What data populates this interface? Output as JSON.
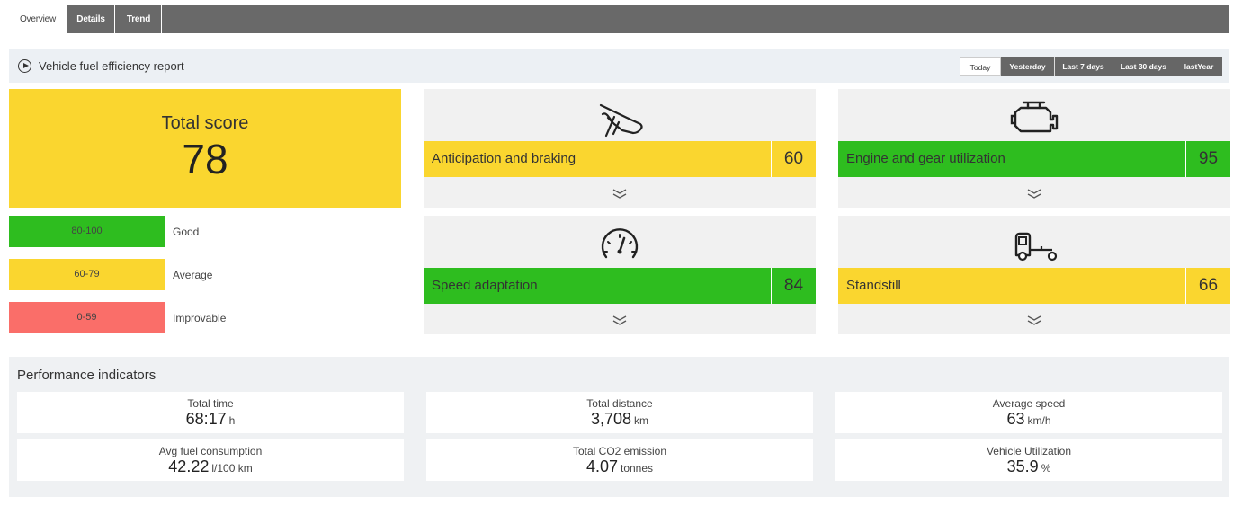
{
  "tabs": [
    {
      "label": "Overview",
      "active": true
    },
    {
      "label": "Details",
      "active": false
    },
    {
      "label": "Trend",
      "active": false
    }
  ],
  "header": {
    "title": "Vehicle fuel efficiency report"
  },
  "periods": [
    {
      "label": "Today",
      "active": true
    },
    {
      "label": "Yesterday",
      "active": false
    },
    {
      "label": "Last 7 days",
      "active": false
    },
    {
      "label": "Last 30 days",
      "active": false
    },
    {
      "label": "lastYear",
      "active": false
    }
  ],
  "total_score": {
    "label": "Total score",
    "value": "78"
  },
  "legend": [
    {
      "range": "80-100",
      "label": "Good",
      "color": "#2ebd1f"
    },
    {
      "range": "60-79",
      "label": "Average",
      "color": "#fad62f"
    },
    {
      "range": "0-59",
      "label": "Improvable",
      "color": "#fa6e69"
    }
  ],
  "categories": [
    {
      "name": "Anticipation and braking",
      "score": "60",
      "icon": "brake-pedal-icon",
      "color": "#fad62f"
    },
    {
      "name": "Engine and gear utilization",
      "score": "95",
      "icon": "engine-icon",
      "color": "#2ebd1f"
    },
    {
      "name": "Speed adaptation",
      "score": "84",
      "icon": "speedometer-icon",
      "color": "#2ebd1f"
    },
    {
      "name": "Standstill",
      "score": "66",
      "icon": "truck-standstill-icon",
      "color": "#fad62f"
    }
  ],
  "performance": {
    "title": "Performance indicators",
    "indicators": [
      {
        "label": "Total time",
        "value": "68:17",
        "unit": "h"
      },
      {
        "label": "Total distance",
        "value": "3,708",
        "unit": "km"
      },
      {
        "label": "Average speed",
        "value": "63",
        "unit": "km/h"
      },
      {
        "label": "Avg fuel consumption",
        "value": "42.22",
        "unit": "l/100 km"
      },
      {
        "label": "Total CO2 emission",
        "value": "4.07",
        "unit": "tonnes"
      },
      {
        "label": "Vehicle Utilization",
        "value": "35.9",
        "unit": "%"
      }
    ]
  }
}
